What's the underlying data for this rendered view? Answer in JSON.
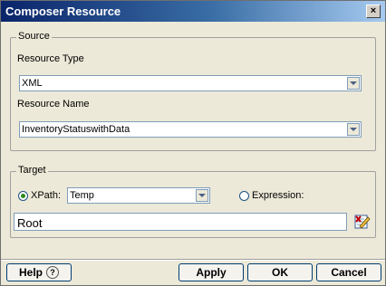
{
  "window": {
    "title": "Composer Resource",
    "close_glyph": "×"
  },
  "source": {
    "legend": "Source",
    "resource_type_label": "Resource Type",
    "resource_type_value": "XML",
    "resource_name_label": "Resource Name",
    "resource_name_value": "InventoryStatuswithData"
  },
  "target": {
    "legend": "Target",
    "xpath_label": "XPath:",
    "xpath_value": "Temp",
    "expression_label": "Expression:",
    "selected_option": "xpath",
    "path_value": "Root"
  },
  "buttons": {
    "help": "Help",
    "apply": "Apply",
    "ok": "OK",
    "cancel": "Cancel"
  },
  "colors": {
    "title_bar_start": "#0a246a",
    "radio_dot": "#2b8a1b"
  },
  "icons": {
    "edit": "edit-expression-icon",
    "help": "question-mark-icon",
    "dropdown": "chevron-down-icon"
  }
}
